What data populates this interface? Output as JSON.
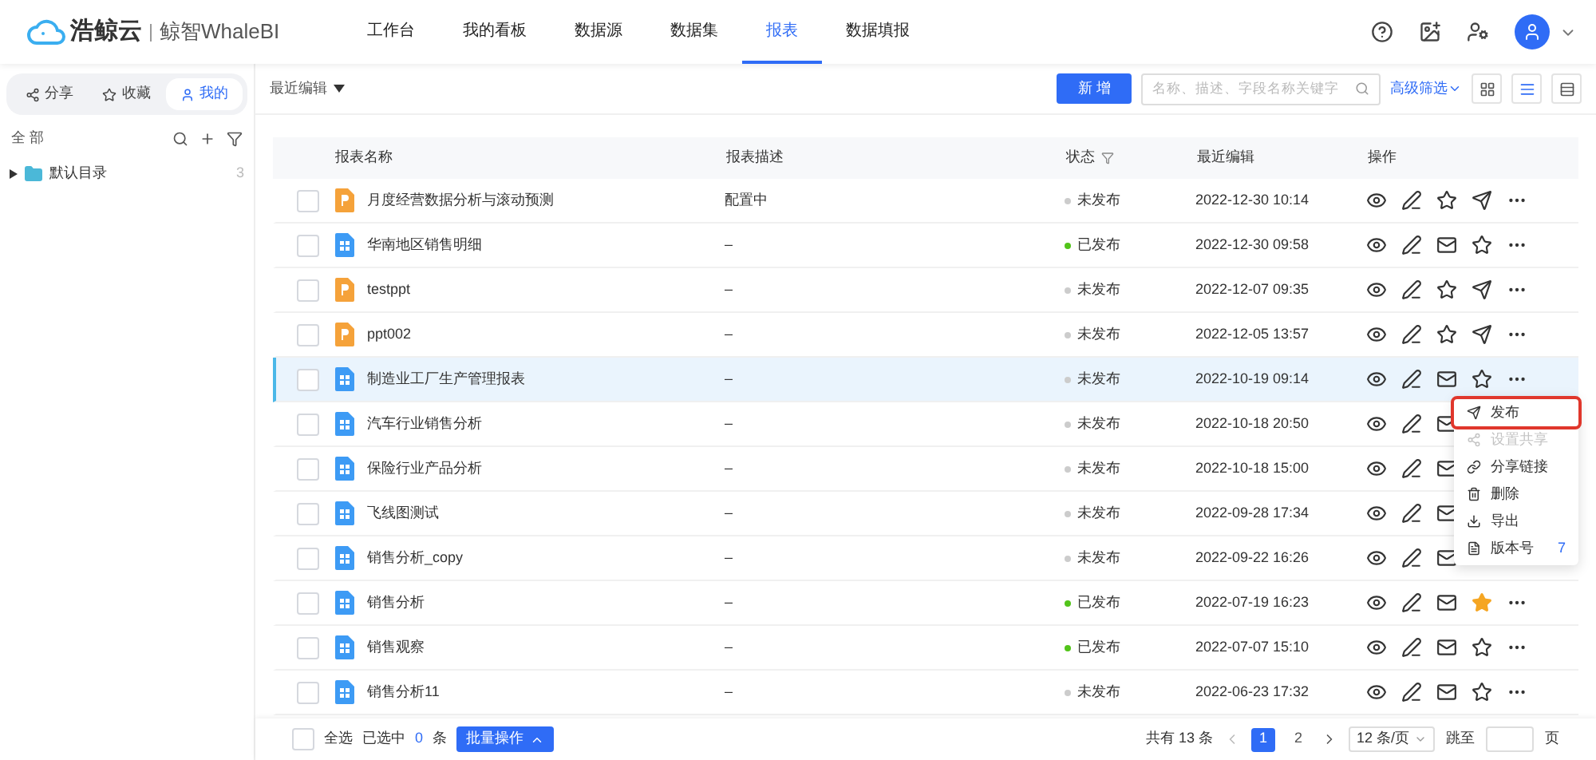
{
  "brand": {
    "name": "浩鲸云",
    "product": "鲸智WhaleBI"
  },
  "nav": [
    {
      "label": "工作台",
      "selected": false
    },
    {
      "label": "我的看板",
      "selected": false
    },
    {
      "label": "数据源",
      "selected": false
    },
    {
      "label": "数据集",
      "selected": false
    },
    {
      "label": "报表",
      "selected": true
    },
    {
      "label": "数据填报",
      "selected": false
    }
  ],
  "sidebar": {
    "tabs": [
      {
        "label": "分享",
        "kind": "share",
        "selected": false
      },
      {
        "label": "收藏",
        "kind": "star",
        "selected": false
      },
      {
        "label": "我的",
        "kind": "user",
        "selected": true
      }
    ],
    "title": "全 部",
    "tree": [
      {
        "label": "默认目录",
        "count": "3",
        "expanded": false
      }
    ]
  },
  "toolbar": {
    "sort": "最近编辑",
    "add": "新 增",
    "search_placeholder": "名称、描述、字段名称关键字",
    "filter": "高级筛选",
    "views": [
      {
        "kind": "grid",
        "selected": false
      },
      {
        "kind": "list",
        "selected": true
      },
      {
        "kind": "table",
        "selected": false
      }
    ]
  },
  "table": {
    "columns": [
      "报表名称",
      "报表描述",
      "状态",
      "最近编辑",
      "操作"
    ],
    "rows": [
      {
        "kind": "ppt",
        "name": "月度经营数据分析与滚动预测",
        "desc": "配置中",
        "published": false,
        "status": "未发布",
        "time": "2022-12-30 10:14",
        "starred": false,
        "selected": false,
        "checked": false
      },
      {
        "kind": "report",
        "name": "华南地区销售明细",
        "desc": "–",
        "published": true,
        "status": "已发布",
        "time": "2022-12-30 09:58",
        "starred": false,
        "selected": false,
        "checked": false
      },
      {
        "kind": "ppt",
        "name": "testppt",
        "desc": "–",
        "published": false,
        "status": "未发布",
        "time": "2022-12-07 09:35",
        "starred": false,
        "selected": false,
        "checked": false
      },
      {
        "kind": "ppt",
        "name": "ppt002",
        "desc": "–",
        "published": false,
        "status": "未发布",
        "time": "2022-12-05 13:57",
        "starred": false,
        "selected": false,
        "checked": false
      },
      {
        "kind": "report",
        "name": "制造业工厂生产管理报表",
        "desc": "–",
        "published": false,
        "status": "未发布",
        "time": "2022-10-19 09:14",
        "starred": false,
        "selected": true,
        "checked": false
      },
      {
        "kind": "report",
        "name": "汽车行业销售分析",
        "desc": "–",
        "published": false,
        "status": "未发布",
        "time": "2022-10-18 20:50",
        "selected": false,
        "checked": false
      },
      {
        "kind": "report",
        "name": "保险行业产品分析",
        "desc": "–",
        "published": false,
        "status": "未发布",
        "time": "2022-10-18 15:00",
        "selected": false,
        "checked": false
      },
      {
        "kind": "report",
        "name": "飞线图测试",
        "desc": "–",
        "published": false,
        "status": "未发布",
        "time": "2022-09-28 17:34",
        "selected": false,
        "checked": false
      },
      {
        "kind": "report",
        "name": "销售分析_copy",
        "desc": "–",
        "published": false,
        "status": "未发布",
        "time": "2022-09-22 16:26",
        "selected": false,
        "checked": false
      },
      {
        "kind": "report",
        "name": "销售分析",
        "desc": "–",
        "published": true,
        "status": "已发布",
        "time": "2022-07-19 16:23",
        "starred": true,
        "selected": false,
        "checked": false
      },
      {
        "kind": "report",
        "name": "销售观察",
        "desc": "–",
        "published": true,
        "status": "已发布",
        "time": "2022-07-07 15:10",
        "starred": false,
        "selected": false,
        "checked": false
      },
      {
        "kind": "report",
        "name": "销售分析11",
        "desc": "–",
        "published": false,
        "status": "未发布",
        "time": "2022-06-23 17:32",
        "starred": false,
        "selected": false,
        "checked": false
      }
    ]
  },
  "menu": [
    {
      "kind": "send",
      "label": "发布",
      "disabled": false,
      "selected": true
    },
    {
      "kind": "share",
      "label": "设置共享",
      "disabled": true,
      "selected": false
    },
    {
      "kind": "link",
      "label": "分享链接",
      "disabled": false,
      "selected": false
    },
    {
      "kind": "trash",
      "label": "删除",
      "disabled": false,
      "selected": false
    },
    {
      "kind": "download",
      "label": "导出",
      "disabled": false,
      "selected": false
    },
    {
      "kind": "version",
      "label": "版本号",
      "badge": "7",
      "disabled": false,
      "selected": false
    }
  ],
  "footer": {
    "select_all": "全选",
    "select_all_checked": false,
    "selected_prefix": "已选中",
    "selected_count": "0",
    "selected_suffix": "条",
    "batch": "批量操作",
    "total": "共有 13 条",
    "pages": [
      {
        "label": "1",
        "selected": true
      },
      {
        "label": "2",
        "selected": false
      }
    ],
    "page_size": "12 条/页",
    "jump": "跳至",
    "page_suffix": "页"
  }
}
